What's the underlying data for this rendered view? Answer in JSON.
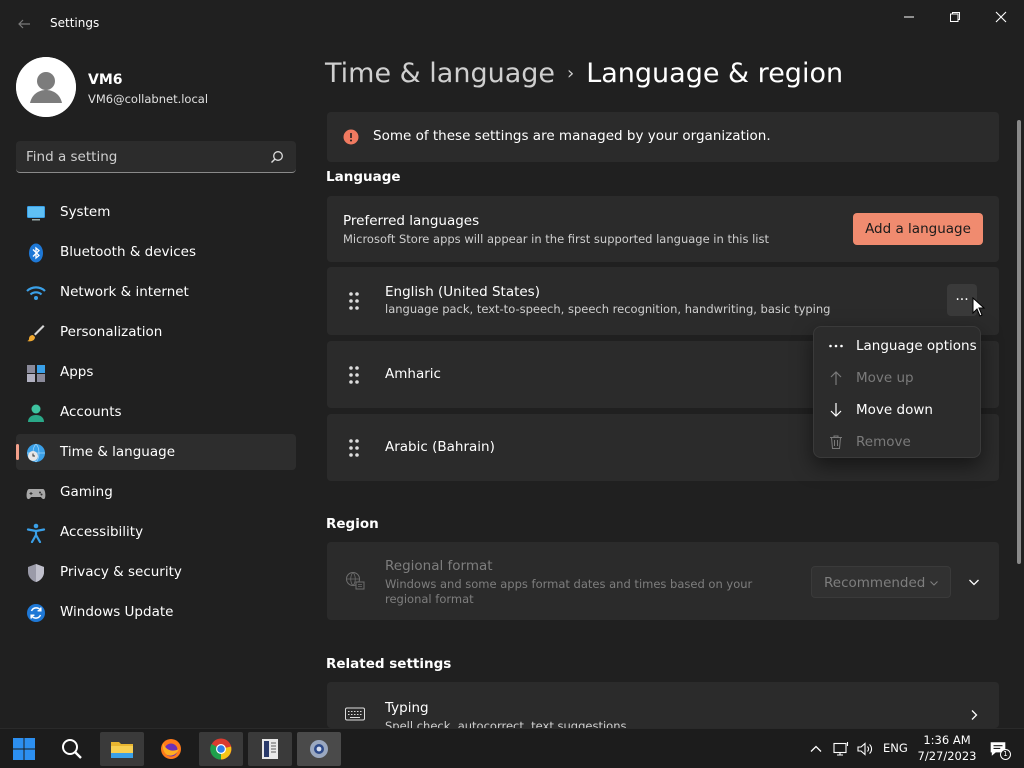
{
  "window": {
    "app_title": "Settings"
  },
  "profile": {
    "name": "VM6",
    "email": "VM6@collabnet.local"
  },
  "search": {
    "placeholder": "Find a setting"
  },
  "nav": {
    "items": [
      {
        "label": "System",
        "icon": "system-icon"
      },
      {
        "label": "Bluetooth & devices",
        "icon": "bluetooth-icon"
      },
      {
        "label": "Network & internet",
        "icon": "wifi-icon"
      },
      {
        "label": "Personalization",
        "icon": "brush-icon"
      },
      {
        "label": "Apps",
        "icon": "apps-icon"
      },
      {
        "label": "Accounts",
        "icon": "account-icon"
      },
      {
        "label": "Time & language",
        "icon": "globe-clock-icon",
        "active": true
      },
      {
        "label": "Gaming",
        "icon": "gamepad-icon"
      },
      {
        "label": "Accessibility",
        "icon": "accessibility-icon"
      },
      {
        "label": "Privacy & security",
        "icon": "shield-icon"
      },
      {
        "label": "Windows Update",
        "icon": "update-icon"
      }
    ]
  },
  "breadcrumb": {
    "parent": "Time & language",
    "separator": "›",
    "current": "Language & region"
  },
  "notice": {
    "text": "Some of these settings are managed by your organization."
  },
  "language_section": {
    "label": "Language",
    "preferred_title": "Preferred languages",
    "preferred_sub": "Microsoft Store apps will appear in the first supported language in this list",
    "add_button": "Add a language",
    "languages": [
      {
        "name": "English (United States)",
        "features": "language pack, text-to-speech, speech recognition, handwriting, basic typing"
      },
      {
        "name": "Amharic",
        "features": ""
      },
      {
        "name": "Arabic (Bahrain)",
        "features": ""
      }
    ],
    "more_glyph": "···"
  },
  "context_menu": {
    "items": [
      {
        "label": "Language options",
        "icon": "more-horizontal-icon",
        "enabled": true
      },
      {
        "label": "Move up",
        "icon": "arrow-up-icon",
        "enabled": false
      },
      {
        "label": "Move down",
        "icon": "arrow-down-icon",
        "enabled": true
      },
      {
        "label": "Remove",
        "icon": "trash-icon",
        "enabled": false
      }
    ]
  },
  "region_section": {
    "label": "Region",
    "format_title": "Regional format",
    "format_sub": "Windows and some apps format dates and times based on your regional format",
    "format_value": "Recommended"
  },
  "related_section": {
    "label": "Related settings",
    "typing_title": "Typing",
    "typing_sub": "Spell check, autocorrect, text suggestions"
  },
  "taskbar": {
    "lang": "ENG",
    "time": "1:36 AM",
    "date": "7/27/2023",
    "notification_count": "1"
  },
  "colors": {
    "accent": "#f08b6f",
    "background": "#202020",
    "card": "#2b2b2b"
  }
}
